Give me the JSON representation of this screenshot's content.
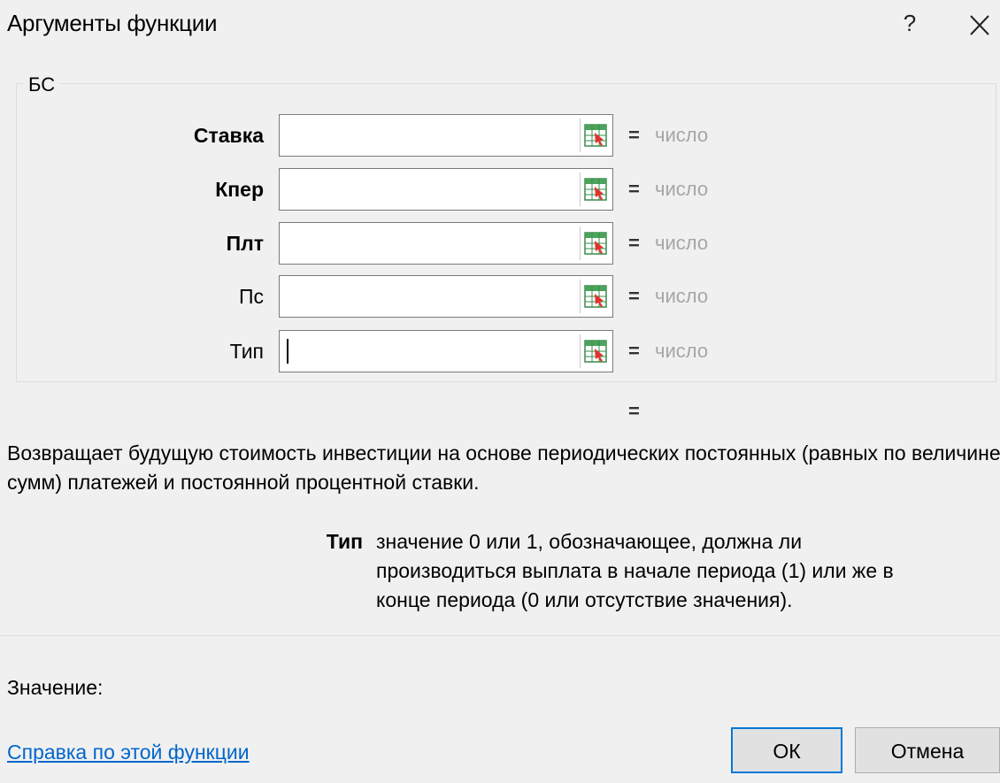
{
  "window": {
    "title": "Аргументы функции",
    "help_label": "?"
  },
  "function": {
    "name": "БС",
    "arguments": [
      {
        "label": "Ставка",
        "value": "",
        "result": "число",
        "bold": true
      },
      {
        "label": "Кпер",
        "value": "",
        "result": "число",
        "bold": true
      },
      {
        "label": "Плт",
        "value": "",
        "result": "число",
        "bold": true
      },
      {
        "label": "Пс",
        "value": "",
        "result": "число",
        "bold": false
      },
      {
        "label": "Тип",
        "value": "",
        "result": "число",
        "bold": false
      }
    ],
    "equals_sign": "=",
    "total_result": ""
  },
  "description": "Возвращает будущую стоимость инвестиции на основе периодических постоянных (равных по величине\nсумм) платежей и постоянной процентной ставки.",
  "active_argument": {
    "name": "Тип",
    "description": "значение 0 или 1, обозначающее, должна ли производиться выплата в начале периода (1) или же в конце периода (0 или отсутствие значения)."
  },
  "footer": {
    "value_label": "Значение:",
    "help_link": "Справка по этой функции",
    "ok_label": "ОК",
    "cancel_label": "Отмена"
  },
  "colors": {
    "accent": "#0078d7",
    "link": "#0066cc",
    "muted_result": "#a6a6a6"
  },
  "icons": {
    "help": "question-mark-icon",
    "close": "close-icon",
    "range_select": "collapse-dialog-range-icon"
  }
}
